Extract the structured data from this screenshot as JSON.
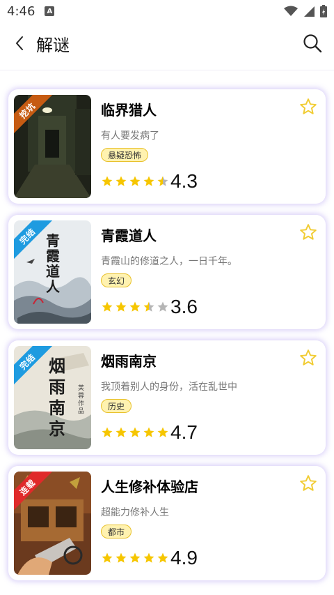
{
  "status_bar": {
    "time": "4:46",
    "notification_icon": "a-icon"
  },
  "header": {
    "title": "解谜"
  },
  "books": [
    {
      "title": "临界猎人",
      "description": "有人要发病了",
      "tag": "悬疑恐怖",
      "badge": "挖坑",
      "badge_color": "#c65b12",
      "rating": 4.3,
      "rating_text": "4.3",
      "stars": [
        1,
        1,
        1,
        1,
        0.5
      ]
    },
    {
      "title": "青霞道人",
      "description": "青霞山的修道之人，一日千年。",
      "tag": "玄幻",
      "badge": "完结",
      "badge_color": "#1e9be0",
      "cover_text": "青霞道人",
      "rating": 3.6,
      "rating_text": "3.6",
      "stars": [
        1,
        1,
        1,
        0.5,
        0
      ]
    },
    {
      "title": "烟雨南京",
      "description": "我顶着别人的身份，活在乱世中",
      "tag": "历史",
      "badge": "完结",
      "badge_color": "#1e9be0",
      "cover_text": "烟雨南京",
      "cover_subtext": "芙蓉 作品",
      "rating": 4.7,
      "rating_text": "4.7",
      "stars": [
        1,
        1,
        1,
        1,
        1
      ]
    },
    {
      "title": "人生修补体验店",
      "description": "超能力修补人生",
      "tag": "都市",
      "badge": "连载",
      "badge_color": "#e02a2a",
      "rating": 4.9,
      "rating_text": "4.9",
      "stars": [
        1,
        1,
        1,
        1,
        1
      ]
    }
  ],
  "colors": {
    "star_filled": "#f6c600",
    "star_empty": "#b5b5b5",
    "tag_bg": "#fff2b0",
    "tag_border": "#e8c12a",
    "card_glow": "#aa96f0"
  }
}
